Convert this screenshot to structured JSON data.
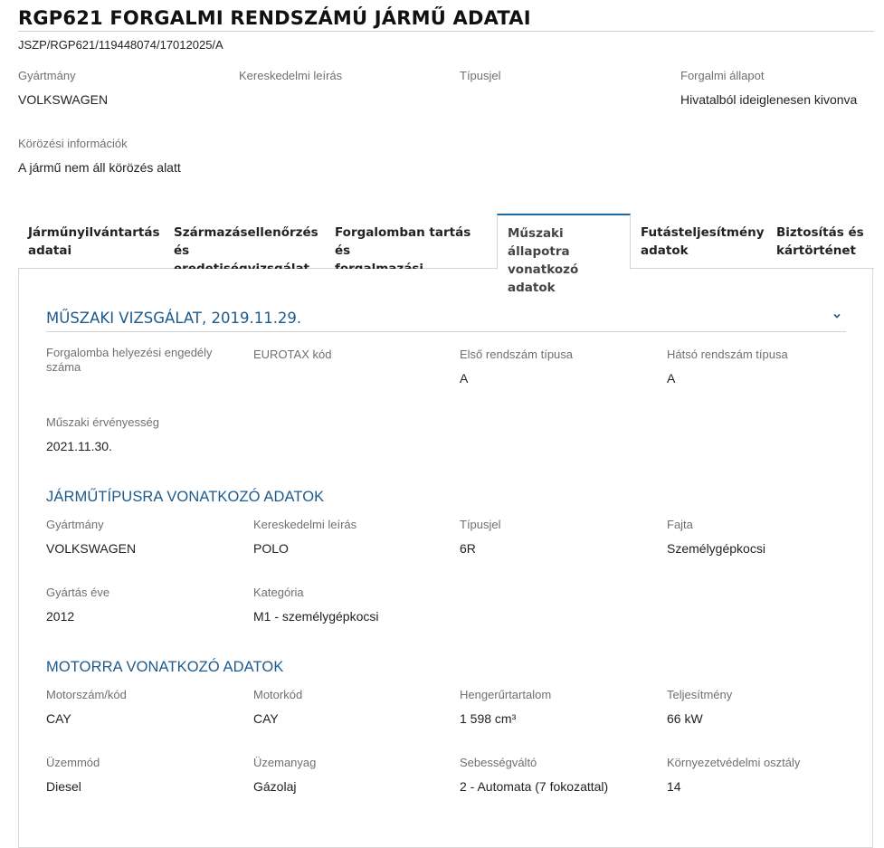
{
  "header": {
    "title": "RGP621 FORGALMI RENDSZÁMÚ JÁRMŰ ADATAI",
    "reference": "JSZP/RGP621/119448074/17012025/A"
  },
  "summary": [
    {
      "label": "Gyártmány",
      "value": "VOLKSWAGEN"
    },
    {
      "label": "Kereskedelmi leírás",
      "value": ""
    },
    {
      "label": "Típusjel",
      "value": ""
    },
    {
      "label": "Forgalmi állapot",
      "value": "Hivatalból ideiglenesen kivonva"
    },
    {
      "label": "Körözési információk",
      "value": "A jármű nem áll körözés alatt"
    }
  ],
  "tabs": [
    {
      "line1": "Járműnyilvántartás",
      "line2": "adatai"
    },
    {
      "line1": "Származásellenőrzés",
      "line2": "és eredetiségvizsgálat"
    },
    {
      "line1": "Forgalomban tartás és",
      "line2": "forgalmazási korlátozás"
    },
    {
      "line1": "Műszaki állapotra",
      "line2": "vonatkozó adatok"
    },
    {
      "line1": "Futásteljesítmény",
      "line2": "adatok"
    },
    {
      "line1": "Biztosítás és",
      "line2": "kártörténet"
    }
  ],
  "inspection": {
    "title": "MŰSZAKI VIZSGÁLAT, 2019.11.29.",
    "fields": [
      {
        "label": "Forgalomba helyezési engedély száma",
        "value": ""
      },
      {
        "label": "EUROTAX kód",
        "value": ""
      },
      {
        "label": "Első rendszám típusa",
        "value": "A"
      },
      {
        "label": "Hátsó rendszám típusa",
        "value": "A"
      },
      {
        "label": "Műszaki érvényesség",
        "value": "2021.11.30."
      }
    ]
  },
  "vehicle_type": {
    "title": "JÁRMŰTÍPUSRA VONATKOZÓ ADATOK",
    "fields": [
      {
        "label": "Gyártmány",
        "value": "VOLKSWAGEN"
      },
      {
        "label": "Kereskedelmi leírás",
        "value": "POLO"
      },
      {
        "label": "Típusjel",
        "value": "6R"
      },
      {
        "label": "Fajta",
        "value": "Személygépkocsi"
      },
      {
        "label": "Gyártás éve",
        "value": "2012"
      },
      {
        "label": "Kategória",
        "value": "M1 - személygépkocsi"
      }
    ]
  },
  "engine": {
    "title": "MOTORRA VONATKOZÓ ADATOK",
    "fields": [
      {
        "label": "Motorszám/kód",
        "value": "CAY"
      },
      {
        "label": "Motorkód",
        "value": "CAY"
      },
      {
        "label": "Hengerűrtartalom",
        "value": "1 598 cm³"
      },
      {
        "label": "Teljesítmény",
        "value": "66 kW"
      },
      {
        "label": "Üzemmód",
        "value": "Diesel"
      },
      {
        "label": "Üzemanyag",
        "value": "Gázolaj"
      },
      {
        "label": "Sebességváltó",
        "value": "2 - Automata (7 fokozattal)"
      },
      {
        "label": "Környezetvédelmi osztály",
        "value": "14"
      }
    ]
  },
  "colors": {
    "accent": "#1f6aa5",
    "section": "#1e5a8c",
    "label": "#707070"
  },
  "icons": {
    "accordion": "chevron-down-icon"
  }
}
